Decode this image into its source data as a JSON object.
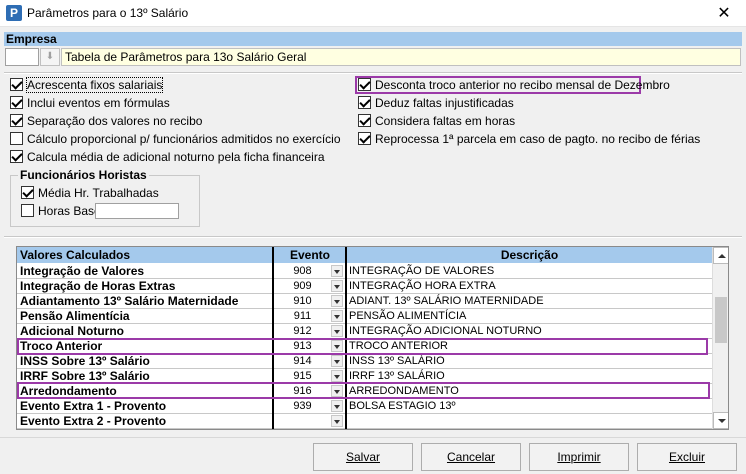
{
  "window": {
    "title": "Parâmetros para o 13º Salário",
    "close_label": "✕",
    "icon_label": "P"
  },
  "empresa": {
    "header": "Empresa",
    "code": "",
    "name": "Tabela de Parâmetros para 13o Salário Geral"
  },
  "options_left": [
    {
      "label": "Acrescenta fixos salariais",
      "checked": true
    },
    {
      "label": "Inclui eventos em fórmulas",
      "checked": true
    },
    {
      "label": "Separação dos valores no recibo",
      "checked": true
    },
    {
      "label": "Cálculo proporcional p/ funcionários admitidos no exercício",
      "checked": false
    },
    {
      "label": "Calcula média de adicional noturno pela ficha financeira",
      "checked": true
    }
  ],
  "options_right": [
    {
      "label": "Desconta troco anterior no recibo mensal de Dezembro",
      "checked": true
    },
    {
      "label": "Deduz faltas injustificadas",
      "checked": true
    },
    {
      "label": "Considera faltas em horas",
      "checked": true
    },
    {
      "label": "Reprocessa 1ª parcela em caso de pagto. no recibo de férias",
      "checked": true
    }
  ],
  "horistas": {
    "legend": "Funcionários Horistas",
    "media_label": "Média Hr. Trabalhadas",
    "media_checked": true,
    "horas_label": "Horas Base",
    "horas_checked": false,
    "horas_value": ""
  },
  "grid": {
    "columns": [
      "Valores Calculados",
      "Evento",
      "Descrição"
    ],
    "rows": [
      {
        "name": "Integração de Valores",
        "evento": "908",
        "descricao": "INTEGRAÇÃO DE VALORES"
      },
      {
        "name": "Integração de Horas Extras",
        "evento": "909",
        "descricao": "INTEGRAÇÃO HORA EXTRA"
      },
      {
        "name": "Adiantamento 13º Salário Maternidade",
        "evento": "910",
        "descricao": "ADIANT. 13º SALÁRIO MATERNIDADE"
      },
      {
        "name": "Pensão Alimentícia",
        "evento": "911",
        "descricao": "PENSÃO ALIMENTÍCIA"
      },
      {
        "name": "Adicional Noturno",
        "evento": "912",
        "descricao": "INTEGRAÇÃO ADICIONAL NOTURNO"
      },
      {
        "name": "Troco Anterior",
        "evento": "913",
        "descricao": "TROCO ANTERIOR"
      },
      {
        "name": "INSS Sobre 13º Salário",
        "evento": "914",
        "descricao": "INSS 13º SALÁRIO"
      },
      {
        "name": "IRRF Sobre 13º Salário",
        "evento": "915",
        "descricao": "IRRF 13º SALÁRIO"
      },
      {
        "name": "Arredondamento",
        "evento": "916",
        "descricao": "ARREDONDAMENTO"
      },
      {
        "name": "Evento Extra 1 - Provento",
        "evento": "939",
        "descricao": "BOLSA ESTAGIO 13º"
      },
      {
        "name": "Evento Extra 2 - Provento",
        "evento": "",
        "descricao": ""
      }
    ]
  },
  "buttons": {
    "salvar": "Salvar",
    "cancelar": "Cancelar",
    "imprimir": "Imprimir",
    "excluir": "Excluir"
  },
  "highlight_color": "#9b3aa8"
}
